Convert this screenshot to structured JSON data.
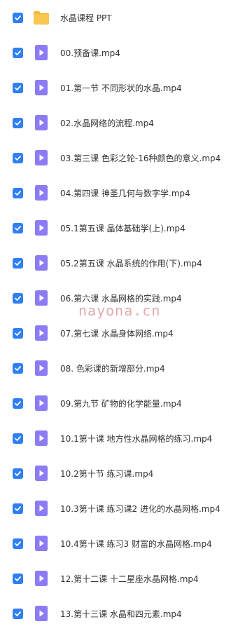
{
  "colors": {
    "checkbox": "#2f7ff5",
    "video_icon": "#8b7cf6",
    "folder": "#f9c74f"
  },
  "watermark": "nayona.cn",
  "files": [
    {
      "name": "水晶课程 PPT",
      "type": "folder",
      "checked": true
    },
    {
      "name": "00.预备课.mp4",
      "type": "video",
      "checked": true
    },
    {
      "name": "01.第一节 不同形状的水晶.mp4",
      "type": "video",
      "checked": true
    },
    {
      "name": "02.水晶网络的流程.mp4",
      "type": "video",
      "checked": true
    },
    {
      "name": "03.第三课 色彩之轮-16种颜色的意义.mp4",
      "type": "video",
      "checked": true
    },
    {
      "name": "04.第四课 神圣几何与数字学.mp4",
      "type": "video",
      "checked": true
    },
    {
      "name": "05.1第五课 晶体基础学(上).mp4",
      "type": "video",
      "checked": true
    },
    {
      "name": "05.2第五课 水晶系统的作用(下).mp4",
      "type": "video",
      "checked": true
    },
    {
      "name": "06.第六课 水晶网格的实践.mp4",
      "type": "video",
      "checked": true
    },
    {
      "name": "07.第七课 水晶身体网络.mp4",
      "type": "video",
      "checked": true
    },
    {
      "name": "08. 色彩课的新增部分.mp4",
      "type": "video",
      "checked": true
    },
    {
      "name": "09.第九节 矿物的化学能量.mp4",
      "type": "video",
      "checked": true
    },
    {
      "name": "10.1第十课 地方性水晶网格的练习.mp4",
      "type": "video",
      "checked": true
    },
    {
      "name": "10.2第十节 练习课.mp4",
      "type": "video",
      "checked": true
    },
    {
      "name": "10.3第十课 练习课2 进化的水晶网格.mp4",
      "type": "video",
      "checked": true
    },
    {
      "name": "10.4第十课 练习3 财富的水晶网格.mp4",
      "type": "video",
      "checked": true
    },
    {
      "name": "12.第十二课 十二星座水晶网格.mp4",
      "type": "video",
      "checked": true
    },
    {
      "name": "13.第十三课 水晶和四元素.mp4",
      "type": "video",
      "checked": true
    }
  ]
}
